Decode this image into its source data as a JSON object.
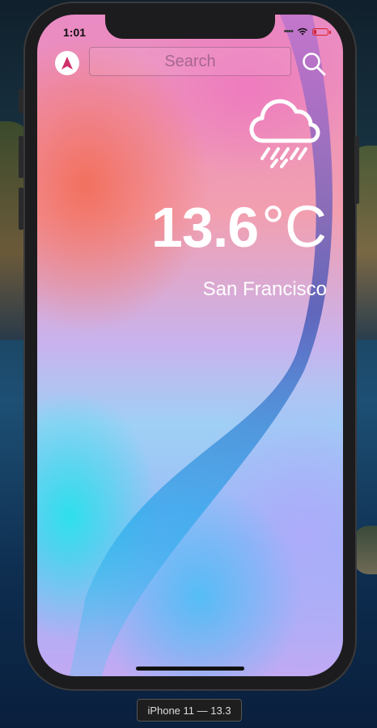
{
  "status_bar": {
    "time": "1:01",
    "signal": "••••",
    "battery_level": 0.15,
    "battery_color": "#d8202a"
  },
  "header": {
    "navigation_icon": "navigation-arrow-icon",
    "search": {
      "placeholder": "Search",
      "value": ""
    },
    "search_icon": "search-icon"
  },
  "weather": {
    "condition_icon": "cloud-rain-icon",
    "temperature": "13.6",
    "unit": "°C",
    "city": "San Francisco"
  },
  "simulator": {
    "device_label": "iPhone 11 — 13.3"
  }
}
